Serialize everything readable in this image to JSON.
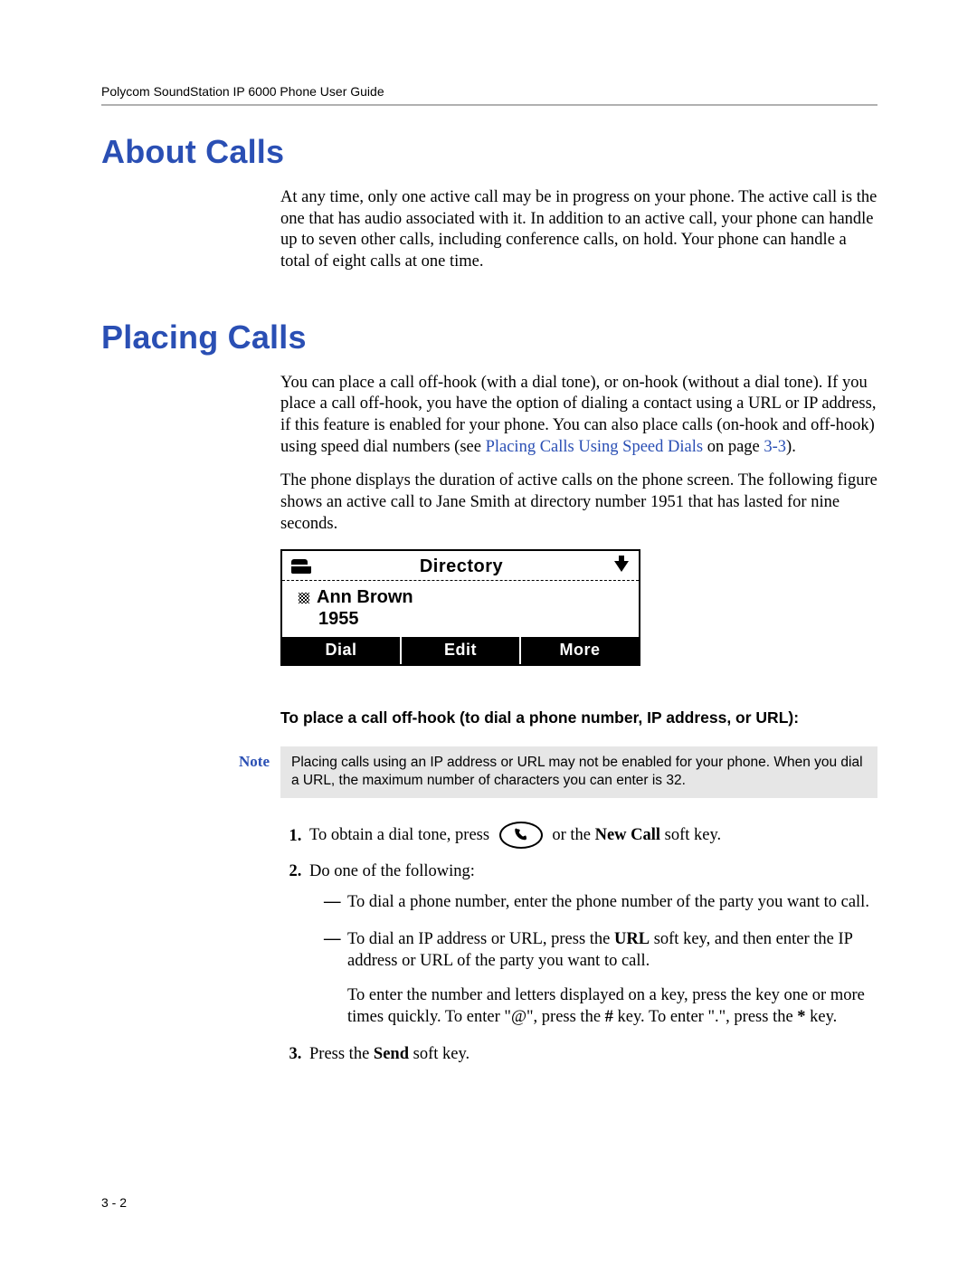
{
  "header": {
    "running": "Polycom SoundStation IP 6000 Phone User Guide"
  },
  "section1": {
    "title": "About Calls",
    "p1": "At any time, only one active call may be in progress on your phone. The active call is the one that has audio associated with it. In addition to an active call, your phone can handle up to seven other calls, including conference calls, on hold. Your phone can handle a total of eight calls at one time."
  },
  "section2": {
    "title": "Placing Calls",
    "p1_a": "You can place a call off-hook (with a dial tone), or on-hook (without a dial tone). If you place a call off-hook, you have the option of dialing a contact using a URL or IP address, if this feature is enabled for your phone. You can also place calls (on-hook and off-hook) using speed dial numbers (see ",
    "p1_link": "Placing Calls Using Speed Dials",
    "p1_b": " on page ",
    "p1_page": "3-3",
    "p1_c": ").",
    "p2": "The phone displays the duration of active calls on the phone screen. The following figure shows an active call to Jane Smith at directory number 1951 that has lasted for nine seconds."
  },
  "phone": {
    "title": "Directory",
    "name": "Ann Brown",
    "number": "1955",
    "softkeys": [
      "Dial",
      "Edit",
      "More"
    ]
  },
  "procedure": {
    "heading": "To place a call off-hook (to dial a phone number, IP address, or URL):",
    "note_label": "Note",
    "note_text": "Placing calls using an IP address or URL may not be enabled for your phone. When you dial a URL, the maximum number of characters you can enter is 32.",
    "step1_a": "To obtain a dial tone, press ",
    "step1_b": " or the ",
    "step1_bold": "New Call",
    "step1_c": " soft key.",
    "step2": "Do one of the following:",
    "dash1": "To dial a phone number, enter the phone number of the party you want to call.",
    "dash2_a": "To dial an IP address or URL, press the ",
    "dash2_bold": "URL",
    "dash2_b": " soft key, and then enter the IP address or URL of the party you want to call.",
    "dash2_para_a": "To enter the number and letters displayed on a key, press the key one or more times quickly. To enter \"@\", press the ",
    "dash2_para_hash": "#",
    "dash2_para_b": " key. To enter \".\", press the ",
    "dash2_para_star": "*",
    "dash2_para_c": " key.",
    "step3_a": "Press the ",
    "step3_bold": "Send",
    "step3_b": " soft key."
  },
  "footer": {
    "page": "3 - 2"
  }
}
